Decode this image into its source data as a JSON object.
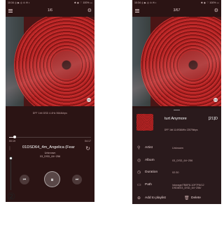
{
  "left_screen": {
    "status": {
      "time": "10:34 ◎ ▶ ◎ ⊙ ✉ •",
      "icons": "✱ ◉ ⌔ 100% ▭"
    },
    "track_counter": "1/6",
    "format_line": "DFF  1bit  DSD 4.4Hz  5644kbps",
    "progress": {
      "elapsed": "00:19",
      "total": "04:17",
      "fraction": 0.07
    },
    "title": "01DSD64_4m_Angelica (Fear",
    "artist": "Unknown",
    "album": "03_DSD_64~256",
    "buttons": {
      "prev": "⏮",
      "play": "⏸",
      "next": "⏭"
    }
  },
  "right_screen": {
    "status": {
      "time": "10:34 ◎ ▶ ◎ ⊙ ✉ •",
      "icons": "✱ ◉ ⌔ 100% ▭"
    },
    "track_counter": "3/67",
    "sheet": {
      "title": "turt Anymore",
      "title_tail": "[21]D",
      "format_line": "DFF  1bit  11.6934MHz  22579kbps",
      "rows": [
        {
          "label": "Artist",
          "value": "Unknown"
        },
        {
          "label": "Album",
          "value": "03_DSD_64~256"
        },
        {
          "label": "Duration",
          "value": "02:30"
        },
        {
          "label": "Path",
          "value_line1": "/storage/7B8F8-10F7F8/12",
          "value_line2": "DSD8/03_DSD_64~256/"
        }
      ],
      "add_label": "Add to playlist",
      "delete_label": "Delete"
    }
  },
  "callout": {
    "number": "②"
  },
  "colors": {
    "background": "#2b1414",
    "vinyl": "#b82424",
    "sheet": "#2a1a1c"
  }
}
